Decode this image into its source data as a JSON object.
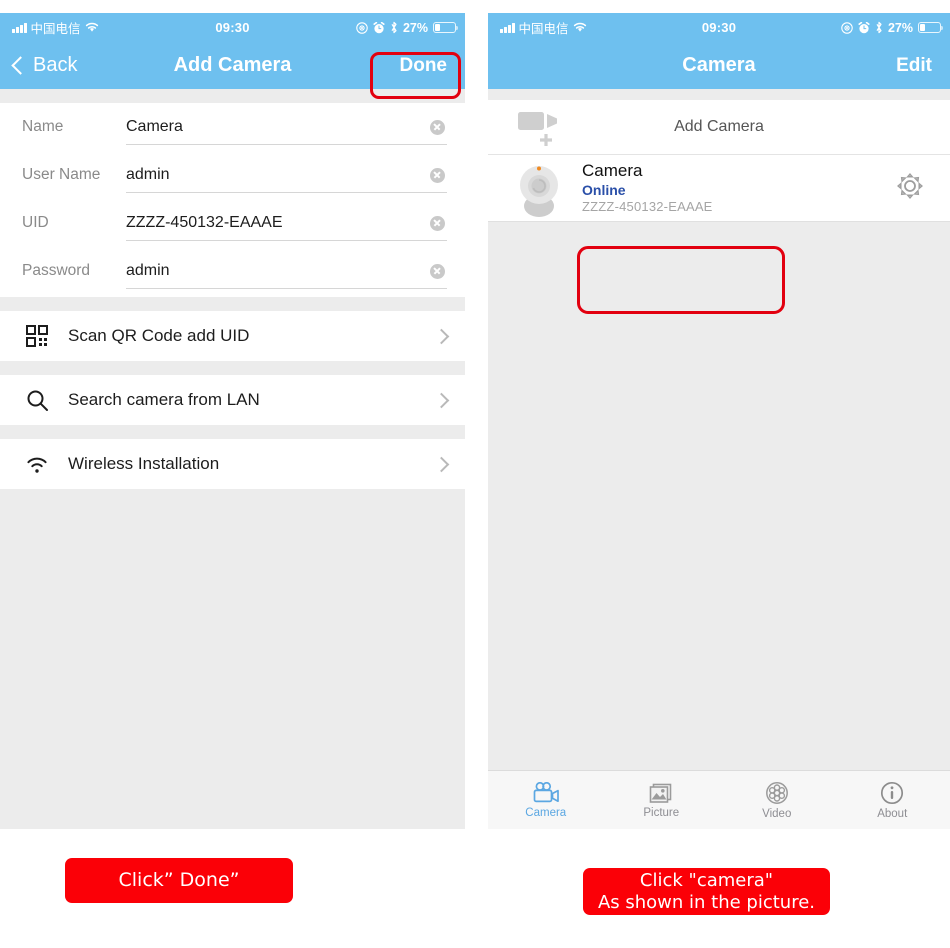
{
  "status_bar": {
    "carrier": "中国电信",
    "time": "09:30",
    "battery_percent": "27%",
    "icons": [
      "signal-bars-icon",
      "wifi-icon",
      "location-icon",
      "alarm-clock-icon",
      "bluetooth-icon",
      "battery-icon"
    ]
  },
  "left_screen": {
    "nav": {
      "back_label": "Back",
      "title": "Add Camera",
      "done_label": "Done"
    },
    "form": {
      "fields": [
        {
          "label": "Name",
          "value": "Camera"
        },
        {
          "label": "User Name",
          "value": "admin"
        },
        {
          "label": "UID",
          "value": "ZZZZ-450132-EAAAE"
        },
        {
          "label": "Password",
          "value": "admin"
        }
      ]
    },
    "actions": [
      {
        "label": "Scan QR Code add UID",
        "icon": "qr-code-icon"
      },
      {
        "label": "Search camera from LAN",
        "icon": "search-icon"
      },
      {
        "label": "Wireless Installation",
        "icon": "wifi-icon"
      }
    ]
  },
  "right_screen": {
    "nav": {
      "title": "Camera",
      "edit_label": "Edit"
    },
    "add_camera_label": "Add Camera",
    "camera": {
      "name": "Camera",
      "status": "Online",
      "uid": "ZZZZ-450132-EAAAE",
      "settings_icon": "gear-icon"
    },
    "tabs": [
      {
        "label": "Camera",
        "icon": "video-camera-icon",
        "active": true
      },
      {
        "label": "Picture",
        "icon": "photo-icon",
        "active": false
      },
      {
        "label": "Video",
        "icon": "film-reel-icon",
        "active": false
      },
      {
        "label": "About",
        "icon": "info-icon",
        "active": false
      }
    ]
  },
  "captions": {
    "left": "Click”  Done”",
    "right_line1": "Click \"camera\"",
    "right_line2": "As shown in the picture."
  },
  "colors": {
    "nav_blue": "#6ec0ef",
    "highlight_red": "#e2000f",
    "caption_red": "#fb0007",
    "status_online": "#2a4fa8",
    "tab_active": "#5ba7e2"
  }
}
